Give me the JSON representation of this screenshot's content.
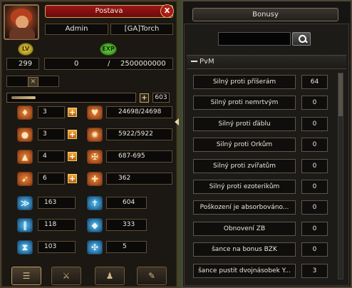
{
  "character": {
    "panel_title": "Postava",
    "close_label": "X",
    "name": "Admin",
    "guild": "[GA]Torch",
    "lv_badge": "LV",
    "exp_badge": "EXP",
    "level": "299",
    "exp_current": "0",
    "exp_separator": "/",
    "exp_max": "2500000000",
    "stat_points": "603",
    "plus_label": "+"
  },
  "stats": [
    {
      "icon": "strength-icon",
      "glyph": "♦",
      "value": "3",
      "derived_icon": "heart-icon",
      "derived_glyph": "♥",
      "derived_value": "24698/24698"
    },
    {
      "icon": "intelligence-icon",
      "glyph": "●",
      "value": "3",
      "derived_icon": "mana-icon",
      "derived_glyph": "✺",
      "derived_value": "5922/5922"
    },
    {
      "icon": "dexterity-icon",
      "glyph": "▲",
      "value": "4",
      "derived_icon": "attack-icon",
      "derived_glyph": "✠",
      "derived_value": "687-695"
    },
    {
      "icon": "vitality-icon",
      "glyph": "➹",
      "value": "6",
      "derived_icon": "defense-icon",
      "derived_glyph": "✚",
      "derived_value": "362"
    }
  ],
  "secondary_stats": [
    {
      "icon": "speed-icon",
      "glyph": "≫",
      "value": "163",
      "icon2": "magic-attack-icon",
      "glyph2": "✝",
      "value2": "604"
    },
    {
      "icon": "dodge-icon",
      "glyph": "‖",
      "value": "118",
      "icon2": "magic-defense-icon",
      "glyph2": "◆",
      "value2": "333"
    },
    {
      "icon": "cast-speed-icon",
      "glyph": "⧗",
      "value": "103",
      "icon2": "critical-icon",
      "glyph2": "✣",
      "value2": "5"
    }
  ],
  "bottom_tabs": [
    {
      "name": "tab-character",
      "glyph": "☰"
    },
    {
      "name": "tab-skills",
      "glyph": "⚔"
    },
    {
      "name": "tab-emotes",
      "glyph": "♟"
    },
    {
      "name": "tab-quests",
      "glyph": "✎"
    }
  ],
  "bonuses": {
    "title": "Bonusy",
    "search_value": "",
    "section": "PvM",
    "items": [
      {
        "label": "Silný proti příšerám",
        "value": "64"
      },
      {
        "label": "Silný proti nemrtvým",
        "value": "0"
      },
      {
        "label": "Silný proti ďáblu",
        "value": "0"
      },
      {
        "label": "Silný proti Orkům",
        "value": "0"
      },
      {
        "label": "Silný proti zvířatům",
        "value": "0"
      },
      {
        "label": "Silný proti ezoterikům",
        "value": "0"
      },
      {
        "label": "Poškození je absorbováno...",
        "value": "0"
      },
      {
        "label": "Obnovení ZB",
        "value": "0"
      },
      {
        "label": "šance na bonus BZK",
        "value": "0"
      },
      {
        "label": "šance pustit dvojnásobek Y...",
        "value": "3"
      }
    ]
  }
}
